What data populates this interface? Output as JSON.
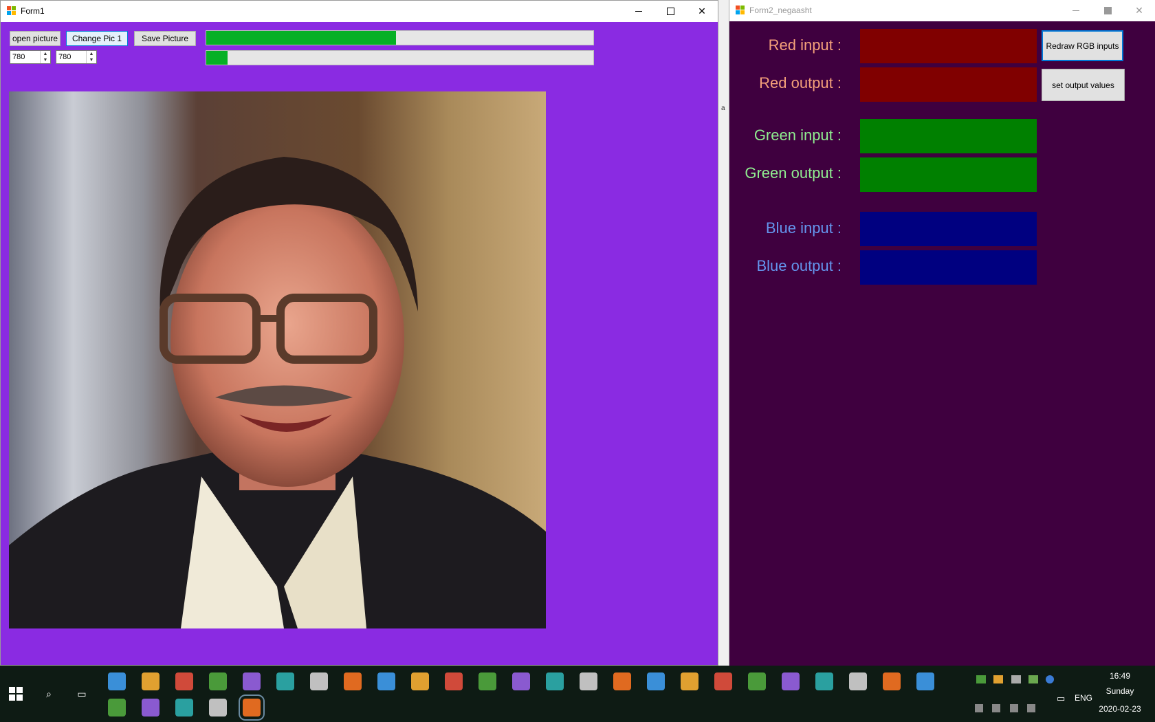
{
  "form1": {
    "title": "Form1",
    "buttons": {
      "open": "open picture",
      "change": "Change Pic 1",
      "save": "Save Picture"
    },
    "width_value": "780",
    "height_value": "780",
    "progress1": 0.49,
    "progress2": 0.055,
    "client_color": "#8a2be2"
  },
  "form2": {
    "title": "Form2_negaasht",
    "labels": {
      "red_in": "Red input :",
      "red_out": "Red output :",
      "green_in": "Green input :",
      "green_out": "Green output :",
      "blue_in": "Blue input :",
      "blue_out": "Blue output :"
    },
    "buttons": {
      "redraw": "Redraw RGB inputs",
      "set_output": "set output values"
    },
    "colors": {
      "background": "#3f003f",
      "red_swatch": "#800000",
      "green_swatch": "#008000",
      "blue_swatch": "#000080",
      "red_label": "#f4a07a",
      "green_label": "#90ee90",
      "blue_label": "#6495ed"
    }
  },
  "gap_label": "a",
  "taskbar": {
    "language": "ENG",
    "time": "16:49",
    "day": "Sunday",
    "date": "2020-02-23",
    "pinned_icons": [
      "start-icon",
      "search-icon",
      "task-view-icon",
      "app-icon",
      "vscode-icon",
      "gimp-icon",
      "app-icon",
      "media-player-icon",
      "edge-e-icon",
      "app-icon",
      "office-icon",
      "app-icon",
      "app-icon",
      "file-icon",
      "calculator-icon",
      "app-icon",
      "app-icon",
      "browser-icon",
      "app-icon",
      "piano-icon",
      "app-icon",
      "app-icon",
      "app-icon",
      "app-icon",
      "app-icon",
      "vlc-icon",
      "app-icon",
      "edge-icon",
      "firefox-icon",
      "csharp-icon",
      "file-explorer-icon",
      "app-icon",
      "form-app-icon"
    ]
  }
}
